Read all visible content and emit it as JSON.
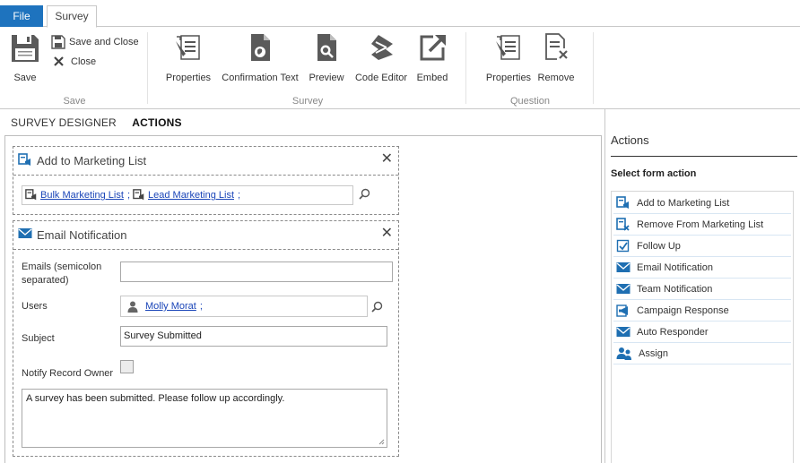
{
  "tabs": {
    "file": "File",
    "survey": "Survey"
  },
  "ribbon": {
    "save": {
      "save": "Save",
      "save_and_close": "Save and Close",
      "close": "Close",
      "group": "Save"
    },
    "survey": {
      "properties": "Properties",
      "confirmation_text": "Confirmation Text",
      "preview": "Preview",
      "code_editor": "Code Editor",
      "embed": "Embed",
      "group": "Survey"
    },
    "question": {
      "properties": "Properties",
      "remove": "Remove",
      "group": "Question"
    }
  },
  "designer_tabs": {
    "designer": "SURVEY DESIGNER",
    "actions": "ACTIONS"
  },
  "marketing_panel": {
    "title": "Add to Marketing List",
    "lists": [
      "Bulk Marketing List",
      "Lead Marketing List"
    ],
    "separator": ";"
  },
  "email_panel": {
    "title": "Email Notification",
    "emails_label": "Emails (semicolon separated)",
    "emails_value": "",
    "users_label": "Users",
    "user": "Molly Morat",
    "subject_label": "Subject",
    "subject_value": "Survey Submitted",
    "notify_owner_label": "Notify Record Owner",
    "notify_owner_checked": false,
    "message": "A survey has been submitted. Please follow up accordingly."
  },
  "sidebar": {
    "title": "Actions",
    "subtitle": "Select form action",
    "items": [
      {
        "label": "Add to Marketing List",
        "icon": "marketing-list-icon"
      },
      {
        "label": "Remove From Marketing List",
        "icon": "remove-list-icon"
      },
      {
        "label": "Follow Up",
        "icon": "checkbox-check-icon"
      },
      {
        "label": "Email Notification",
        "icon": "envelope-icon"
      },
      {
        "label": "Team Notification",
        "icon": "envelope-icon"
      },
      {
        "label": "Campaign Response",
        "icon": "megaphone-icon"
      },
      {
        "label": "Auto Responder",
        "icon": "envelope-icon"
      },
      {
        "label": "Assign",
        "icon": "users-icon"
      }
    ]
  },
  "colors": {
    "accent": "#1e73be",
    "link": "#1a45b8",
    "icon_blue": "#1f6fb2"
  }
}
